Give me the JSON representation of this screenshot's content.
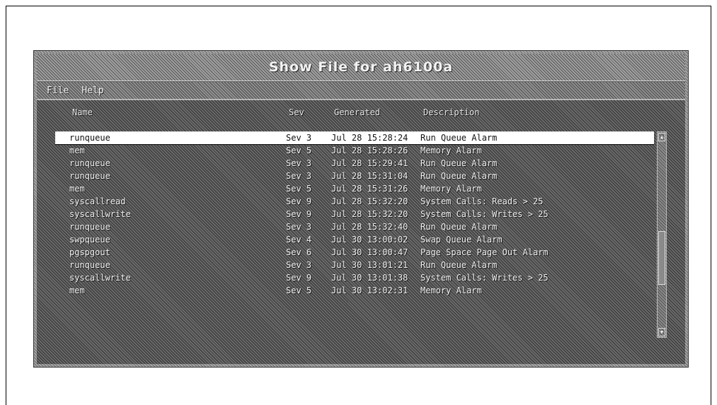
{
  "window": {
    "title": "Show File for ah6100a"
  },
  "menu": {
    "items": [
      "File",
      "Help"
    ]
  },
  "columns": {
    "name": "Name",
    "sev": "Sev",
    "generated": "Generated",
    "description": "Description"
  },
  "rows": [
    {
      "name": "runqueue",
      "sev": "Sev 3",
      "generated": "Jul 28 15:28:24",
      "description": "Run Queue Alarm",
      "selected": true
    },
    {
      "name": "mem",
      "sev": "Sev 5",
      "generated": "Jul 28 15:28:26",
      "description": "Memory Alarm"
    },
    {
      "name": "runqueue",
      "sev": "Sev 3",
      "generated": "Jul 28 15:29:41",
      "description": "Run Queue Alarm"
    },
    {
      "name": "runqueue",
      "sev": "Sev 3",
      "generated": "Jul 28 15:31:04",
      "description": "Run Queue Alarm"
    },
    {
      "name": "mem",
      "sev": "Sev 5",
      "generated": "Jul 28 15:31:26",
      "description": "Memory Alarm"
    },
    {
      "name": "syscallread",
      "sev": "Sev 9",
      "generated": "Jul 28 15:32:20",
      "description": "System Calls: Reads > 25"
    },
    {
      "name": "syscallwrite",
      "sev": "Sev 9",
      "generated": "Jul 28 15:32:20",
      "description": "System Calls: Writes > 25"
    },
    {
      "name": "runqueue",
      "sev": "Sev 3",
      "generated": "Jul 28 15:32:40",
      "description": "Run Queue Alarm"
    },
    {
      "name": "swpqueue",
      "sev": "Sev 4",
      "generated": "Jul 30 13:00:02",
      "description": "Swap Queue Alarm"
    },
    {
      "name": "pgspgout",
      "sev": "Sev 6",
      "generated": "Jul 30 13:00:47",
      "description": "Page Space Page Out Alarm"
    },
    {
      "name": "runqueue",
      "sev": "Sev 3",
      "generated": "Jul 30 13:01:21",
      "description": "Run Queue Alarm"
    },
    {
      "name": "syscallwrite",
      "sev": "Sev 9",
      "generated": "Jul 30 13:01:38",
      "description": "System Calls: Writes > 25"
    },
    {
      "name": "mem",
      "sev": "Sev 5",
      "generated": "Jul 30 13:02:31",
      "description": "Memory Alarm"
    }
  ],
  "icons": {
    "scroll_up": "up-arrow-icon",
    "scroll_down": "down-arrow-icon"
  }
}
